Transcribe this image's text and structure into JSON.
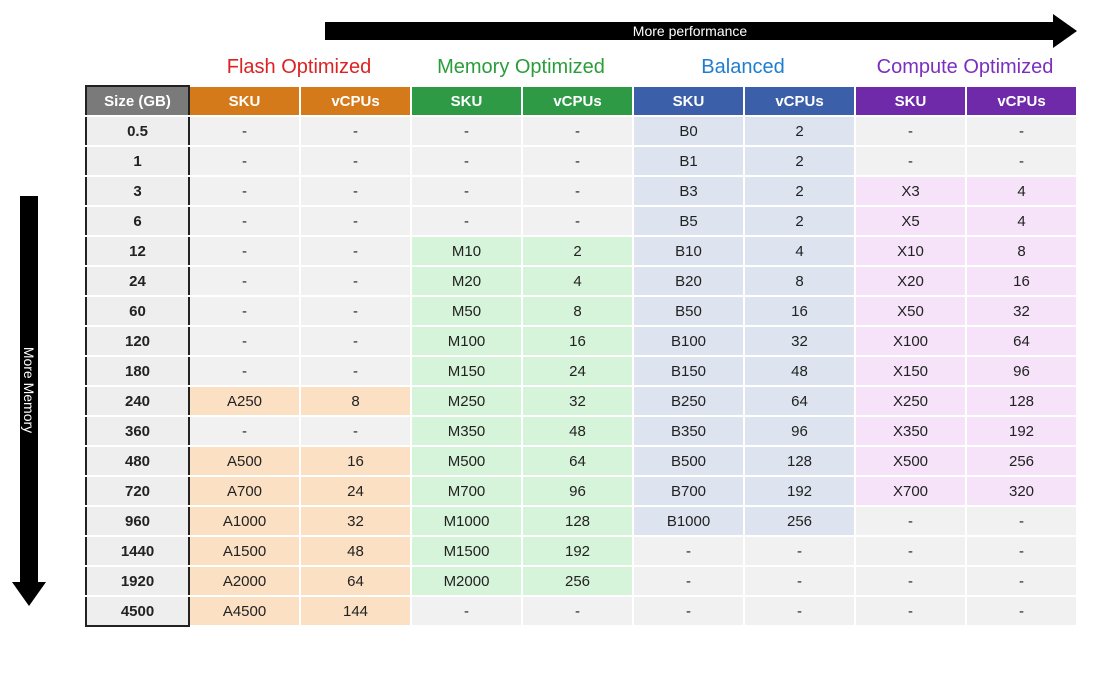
{
  "axes": {
    "top_label": "More performance",
    "left_label": "More Memory"
  },
  "categories": {
    "flash": {
      "title": "Flash Optimized"
    },
    "memory": {
      "title": "Memory Optimized"
    },
    "balanced": {
      "title": "Balanced"
    },
    "compute": {
      "title": "Compute Optimized"
    }
  },
  "headers": {
    "size": "Size (GB)",
    "sku": "SKU",
    "vcpus": "vCPUs"
  },
  "rows": [
    {
      "size": "0.5",
      "flash": {
        "sku": "-",
        "vcpus": "-"
      },
      "memory": {
        "sku": "-",
        "vcpus": "-"
      },
      "balanced": {
        "sku": "B0",
        "vcpus": "2"
      },
      "compute": {
        "sku": "-",
        "vcpus": "-"
      }
    },
    {
      "size": "1",
      "flash": {
        "sku": "-",
        "vcpus": "-"
      },
      "memory": {
        "sku": "-",
        "vcpus": "-"
      },
      "balanced": {
        "sku": "B1",
        "vcpus": "2"
      },
      "compute": {
        "sku": "-",
        "vcpus": "-"
      }
    },
    {
      "size": "3",
      "flash": {
        "sku": "-",
        "vcpus": "-"
      },
      "memory": {
        "sku": "-",
        "vcpus": "-"
      },
      "balanced": {
        "sku": "B3",
        "vcpus": "2"
      },
      "compute": {
        "sku": "X3",
        "vcpus": "4"
      }
    },
    {
      "size": "6",
      "flash": {
        "sku": "-",
        "vcpus": "-"
      },
      "memory": {
        "sku": "-",
        "vcpus": "-"
      },
      "balanced": {
        "sku": "B5",
        "vcpus": "2"
      },
      "compute": {
        "sku": "X5",
        "vcpus": "4"
      }
    },
    {
      "size": "12",
      "flash": {
        "sku": "-",
        "vcpus": "-"
      },
      "memory": {
        "sku": "M10",
        "vcpus": "2"
      },
      "balanced": {
        "sku": "B10",
        "vcpus": "4"
      },
      "compute": {
        "sku": "X10",
        "vcpus": "8"
      }
    },
    {
      "size": "24",
      "flash": {
        "sku": "-",
        "vcpus": "-"
      },
      "memory": {
        "sku": "M20",
        "vcpus": "4"
      },
      "balanced": {
        "sku": "B20",
        "vcpus": "8"
      },
      "compute": {
        "sku": "X20",
        "vcpus": "16"
      }
    },
    {
      "size": "60",
      "flash": {
        "sku": "-",
        "vcpus": "-"
      },
      "memory": {
        "sku": "M50",
        "vcpus": "8"
      },
      "balanced": {
        "sku": "B50",
        "vcpus": "16"
      },
      "compute": {
        "sku": "X50",
        "vcpus": "32"
      }
    },
    {
      "size": "120",
      "flash": {
        "sku": "-",
        "vcpus": "-"
      },
      "memory": {
        "sku": "M100",
        "vcpus": "16"
      },
      "balanced": {
        "sku": "B100",
        "vcpus": "32"
      },
      "compute": {
        "sku": "X100",
        "vcpus": "64"
      }
    },
    {
      "size": "180",
      "flash": {
        "sku": "-",
        "vcpus": "-"
      },
      "memory": {
        "sku": "M150",
        "vcpus": "24"
      },
      "balanced": {
        "sku": "B150",
        "vcpus": "48"
      },
      "compute": {
        "sku": "X150",
        "vcpus": "96"
      }
    },
    {
      "size": "240",
      "flash": {
        "sku": "A250",
        "vcpus": "8"
      },
      "memory": {
        "sku": "M250",
        "vcpus": "32"
      },
      "balanced": {
        "sku": "B250",
        "vcpus": "64"
      },
      "compute": {
        "sku": "X250",
        "vcpus": "128"
      }
    },
    {
      "size": "360",
      "flash": {
        "sku": "-",
        "vcpus": "-"
      },
      "memory": {
        "sku": "M350",
        "vcpus": "48"
      },
      "balanced": {
        "sku": "B350",
        "vcpus": "96"
      },
      "compute": {
        "sku": "X350",
        "vcpus": "192"
      }
    },
    {
      "size": "480",
      "flash": {
        "sku": "A500",
        "vcpus": "16"
      },
      "memory": {
        "sku": "M500",
        "vcpus": "64"
      },
      "balanced": {
        "sku": "B500",
        "vcpus": "128"
      },
      "compute": {
        "sku": "X500",
        "vcpus": "256"
      }
    },
    {
      "size": "720",
      "flash": {
        "sku": "A700",
        "vcpus": "24"
      },
      "memory": {
        "sku": "M700",
        "vcpus": "96"
      },
      "balanced": {
        "sku": "B700",
        "vcpus": "192"
      },
      "compute": {
        "sku": "X700",
        "vcpus": "320"
      }
    },
    {
      "size": "960",
      "flash": {
        "sku": "A1000",
        "vcpus": "32"
      },
      "memory": {
        "sku": "M1000",
        "vcpus": "128"
      },
      "balanced": {
        "sku": "B1000",
        "vcpus": "256"
      },
      "compute": {
        "sku": "-",
        "vcpus": "-"
      }
    },
    {
      "size": "1440",
      "flash": {
        "sku": "A1500",
        "vcpus": "48"
      },
      "memory": {
        "sku": "M1500",
        "vcpus": "192"
      },
      "balanced": {
        "sku": "-",
        "vcpus": "-"
      },
      "compute": {
        "sku": "-",
        "vcpus": "-"
      }
    },
    {
      "size": "1920",
      "flash": {
        "sku": "A2000",
        "vcpus": "64"
      },
      "memory": {
        "sku": "M2000",
        "vcpus": "256"
      },
      "balanced": {
        "sku": "-",
        "vcpus": "-"
      },
      "compute": {
        "sku": "-",
        "vcpus": "-"
      }
    },
    {
      "size": "4500",
      "flash": {
        "sku": "A4500",
        "vcpus": "144"
      },
      "memory": {
        "sku": "-",
        "vcpus": "-"
      },
      "balanced": {
        "sku": "-",
        "vcpus": "-"
      },
      "compute": {
        "sku": "-",
        "vcpus": "-"
      }
    }
  ],
  "chart_data": {
    "type": "table",
    "title": "SKU sizing matrix",
    "xlabel": "More performance",
    "ylabel": "More Memory",
    "columns": [
      "Size (GB)",
      "Flash SKU",
      "Flash vCPUs",
      "Memory SKU",
      "Memory vCPUs",
      "Balanced SKU",
      "Balanced vCPUs",
      "Compute SKU",
      "Compute vCPUs"
    ],
    "rows": [
      [
        "0.5",
        "-",
        "-",
        "-",
        "-",
        "B0",
        "2",
        "-",
        "-"
      ],
      [
        "1",
        "-",
        "-",
        "-",
        "-",
        "B1",
        "2",
        "-",
        "-"
      ],
      [
        "3",
        "-",
        "-",
        "-",
        "-",
        "B3",
        "2",
        "X3",
        "4"
      ],
      [
        "6",
        "-",
        "-",
        "-",
        "-",
        "B5",
        "2",
        "X5",
        "4"
      ],
      [
        "12",
        "-",
        "-",
        "M10",
        "2",
        "B10",
        "4",
        "X10",
        "8"
      ],
      [
        "24",
        "-",
        "-",
        "M20",
        "4",
        "B20",
        "8",
        "X20",
        "16"
      ],
      [
        "60",
        "-",
        "-",
        "M50",
        "8",
        "B50",
        "16",
        "X50",
        "32"
      ],
      [
        "120",
        "-",
        "-",
        "M100",
        "16",
        "B100",
        "32",
        "X100",
        "64"
      ],
      [
        "180",
        "-",
        "-",
        "M150",
        "24",
        "B150",
        "48",
        "X150",
        "96"
      ],
      [
        "240",
        "A250",
        "8",
        "M250",
        "32",
        "B250",
        "64",
        "X250",
        "128"
      ],
      [
        "360",
        "-",
        "-",
        "M350",
        "48",
        "B350",
        "96",
        "X350",
        "192"
      ],
      [
        "480",
        "A500",
        "16",
        "M500",
        "64",
        "B500",
        "128",
        "X500",
        "256"
      ],
      [
        "720",
        "A700",
        "24",
        "M700",
        "96",
        "B700",
        "192",
        "X700",
        "320"
      ],
      [
        "960",
        "A1000",
        "32",
        "M1000",
        "128",
        "B1000",
        "256",
        "-",
        "-"
      ],
      [
        "1440",
        "A1500",
        "48",
        "M1500",
        "192",
        "-",
        "-",
        "-",
        "-"
      ],
      [
        "1920",
        "A2000",
        "64",
        "M2000",
        "256",
        "-",
        "-",
        "-",
        "-"
      ],
      [
        "4500",
        "A4500",
        "144",
        "-",
        "-",
        "-",
        "-",
        "-",
        "-"
      ]
    ]
  }
}
